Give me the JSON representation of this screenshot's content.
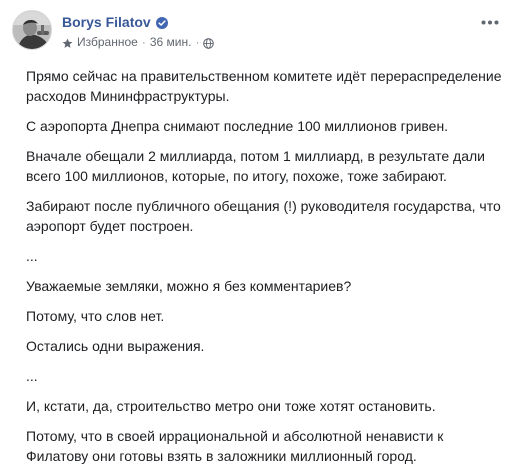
{
  "post": {
    "author": "Borys Filatov",
    "audience_label": "Избранное",
    "time_label": "36 мин.",
    "paragraphs": [
      "Прямо сейчас на правительственном комитете идёт перераспределение расходов Мининфраструктуры.",
      "С аэропорта Днепра снимают последние 100 миллионов гривен.",
      "Вначале обещали 2 миллиарда, потом 1 миллиард, в результате дали всего 100 миллионов, которые, по итогу, похоже, тоже забирают.",
      "Забирают после публичного обещания (!) руководителя государства, что аэропорт будет построен.",
      "...",
      "Уважаемые земляки, можно я без комментариев?",
      "Потому, что слов нет.",
      "Остались одни выражения.",
      "...",
      "И, кстати, да, строительство метро они тоже хотят остановить.",
      "Потому, что в своей иррациональной и абсолютной ненависти к Филатову они готовы взять в заложники миллионный город."
    ]
  },
  "colors": {
    "author_link": "#385898",
    "text": "#1c1e21",
    "meta": "#616770",
    "verified_badge": "#4267b2"
  },
  "icons": {
    "verified": "verified-badge-icon",
    "audience": "star-icon",
    "privacy": "globe-icon",
    "more": "more-dots-icon"
  }
}
